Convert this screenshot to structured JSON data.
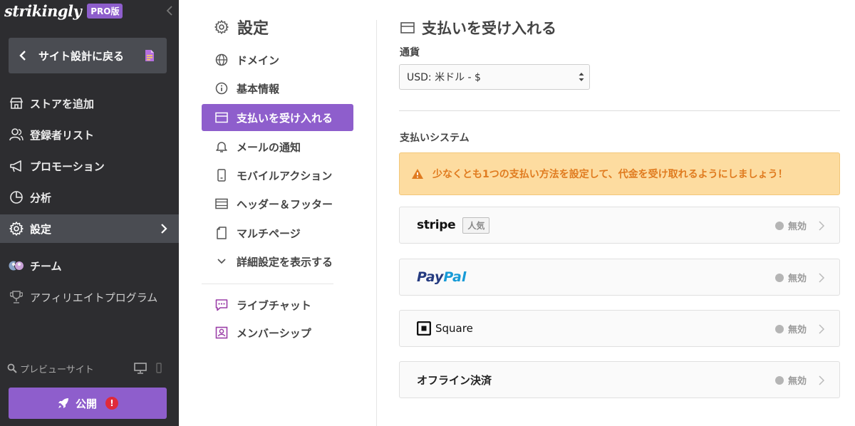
{
  "sidebar": {
    "brand": "strikingly",
    "pro_badge": "PRO版",
    "back_button": "サイト設計に戻る",
    "items": [
      {
        "label": "ストアを追加",
        "icon": "store-icon"
      },
      {
        "label": "登録者リスト",
        "icon": "users-icon"
      },
      {
        "label": "プロモーション",
        "icon": "megaphone-icon"
      },
      {
        "label": "分析",
        "icon": "pie-chart-icon"
      },
      {
        "label": "設定",
        "icon": "gear-icon",
        "active": true
      },
      {
        "label": "チーム",
        "icon": "team-avatars-icon"
      },
      {
        "label": "アフィリエイトプログラム",
        "icon": "trophy-icon"
      }
    ],
    "preview_label": "プレビューサイト",
    "publish_label": "公開",
    "publish_alert": "!"
  },
  "settings_menu": {
    "title": "設定",
    "items": [
      {
        "label": "ドメイン",
        "icon": "globe-icon"
      },
      {
        "label": "基本情報",
        "icon": "info-icon"
      },
      {
        "label": "支払いを受け入れる",
        "icon": "payment-card-icon",
        "active": true
      },
      {
        "label": "メールの通知",
        "icon": "bell-icon"
      },
      {
        "label": "モバイルアクション",
        "icon": "mobile-icon"
      },
      {
        "label": "ヘッダー＆フッター",
        "icon": "header-footer-icon"
      },
      {
        "label": "マルチページ",
        "icon": "pages-icon"
      },
      {
        "label": "詳細設定を表示する",
        "icon": "chevron-down-icon"
      }
    ],
    "extras": [
      {
        "label": "ライブチャット",
        "icon": "chat-icon"
      },
      {
        "label": "メンバーシップ",
        "icon": "member-icon"
      }
    ]
  },
  "content": {
    "title": "支払いを受け入れる",
    "currency_label": "通貨",
    "currency_value": "USD: 米ドル - $",
    "payment_system_label": "支払いシステム",
    "warning": "少なくとも1つの支払い方法を設定して、代金を受け取れるようにしましょう！",
    "providers": [
      {
        "name": "stripe",
        "badge": "人気",
        "status": "無効"
      },
      {
        "name_part1": "Pay",
        "name_part2": "Pal",
        "status": "無効"
      },
      {
        "name": "Square",
        "status": "無効"
      },
      {
        "name": "オフライン決済",
        "status": "無効"
      }
    ]
  },
  "colors": {
    "sidebar_bg": "#2d2d30",
    "accent": "#8e5ecc",
    "warning_bg": "#fddca0",
    "warning_text": "#e07b1f",
    "alert": "#e02a3a"
  }
}
